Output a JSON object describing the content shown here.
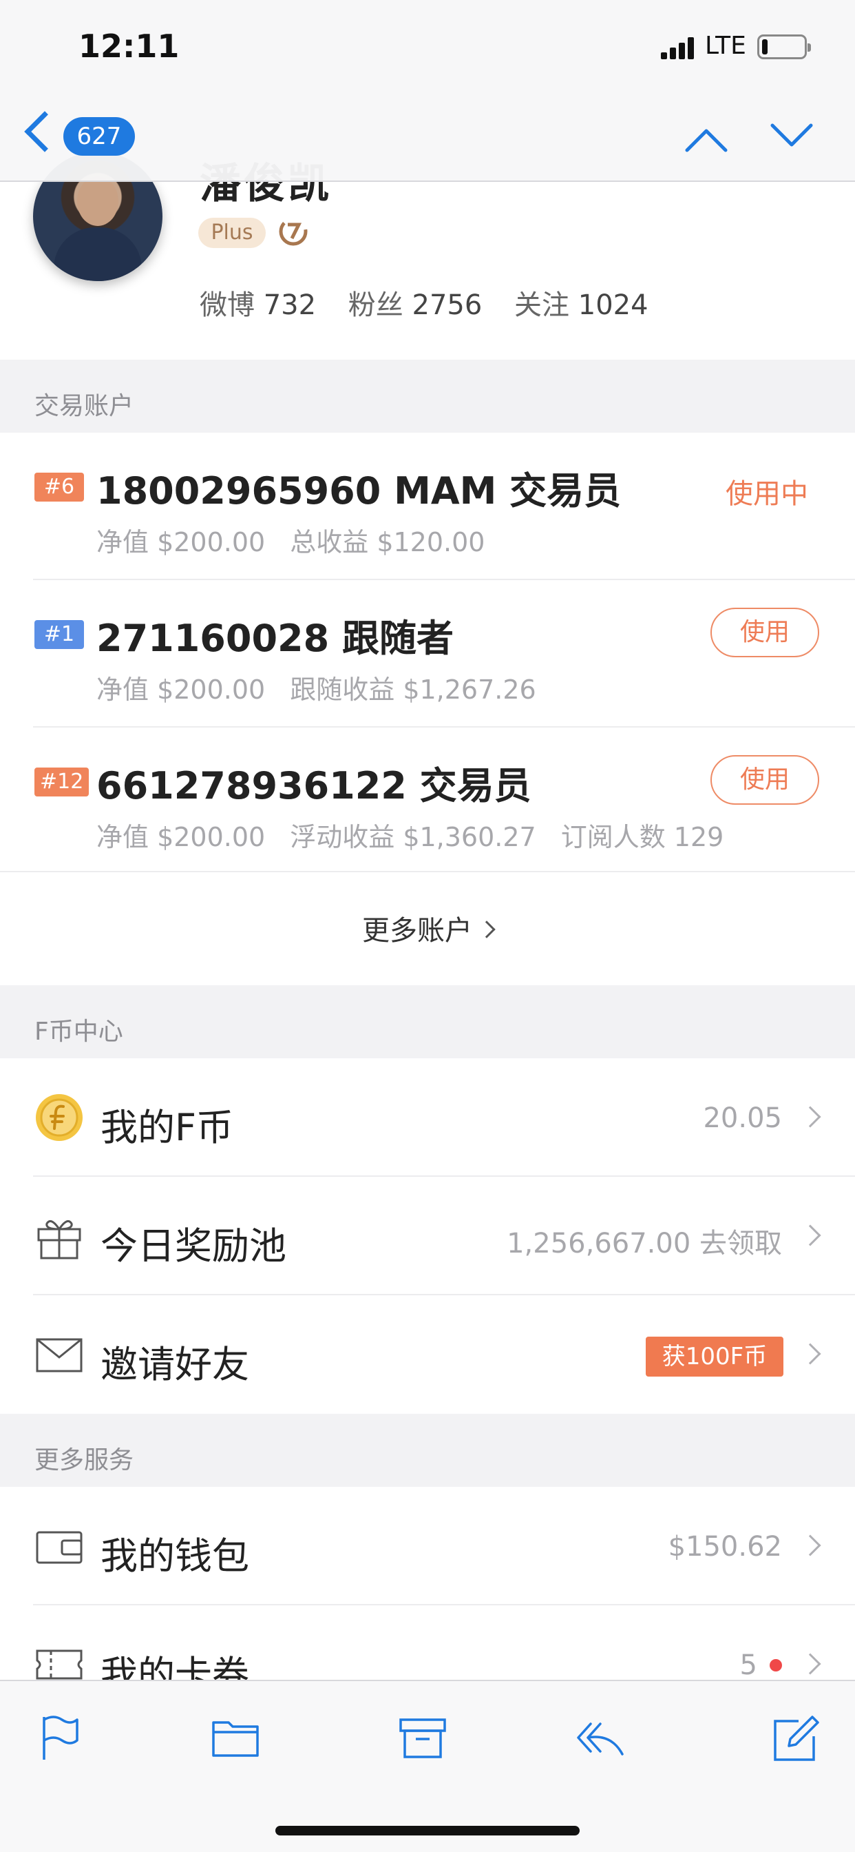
{
  "status_bar": {
    "time": "12:11",
    "network": "LTE"
  },
  "nav": {
    "unread_count": "627"
  },
  "profile": {
    "name": "潘俊凯",
    "badge": "Plus",
    "stats": [
      {
        "label": "微博",
        "value": "732"
      },
      {
        "label": "粉丝",
        "value": "2756"
      },
      {
        "label": "关注",
        "value": "1024"
      }
    ]
  },
  "sections": {
    "accounts_title": "交易账户",
    "fcoin_title": "F币中心",
    "services_title": "更多服务"
  },
  "accounts": [
    {
      "tag": "#6",
      "tag_color": "#f0845a",
      "title": "18002965960 MAM 交易员",
      "metrics": [
        "净值 $200.00",
        "总收益 $120.00"
      ],
      "status": "使用中"
    },
    {
      "tag": "#1",
      "tag_color": "#5b8fe6",
      "title": "271160028 跟随者",
      "metrics": [
        "净值 $200.00",
        "跟随收益 $1,267.26"
      ],
      "action": "使用"
    },
    {
      "tag": "#12",
      "tag_color": "#f0845a",
      "title": "661278936122 交易员",
      "metrics": [
        "净值 $200.00",
        "浮动收益 $1,360.27",
        "订阅人数 129"
      ],
      "action": "使用"
    }
  ],
  "more_accounts_label": "更多账户",
  "fcoin_rows": [
    {
      "icon": "coin-icon",
      "label": "我的F币",
      "value": "20.05"
    },
    {
      "icon": "gift-icon",
      "label": "今日奖励池",
      "value": "1,256,667.00 去领取"
    },
    {
      "icon": "envelope-icon",
      "label": "邀请好友",
      "badge": "获100F币"
    }
  ],
  "service_rows": [
    {
      "icon": "wallet-icon",
      "label": "我的钱包",
      "value": "$150.62"
    },
    {
      "icon": "ticket-icon",
      "label": "我的卡券",
      "value": "5"
    }
  ],
  "colors": {
    "accent_blue": "#1f7ae0",
    "accent_orange": "#ee7c55",
    "badge_orange": "#f07a50"
  }
}
